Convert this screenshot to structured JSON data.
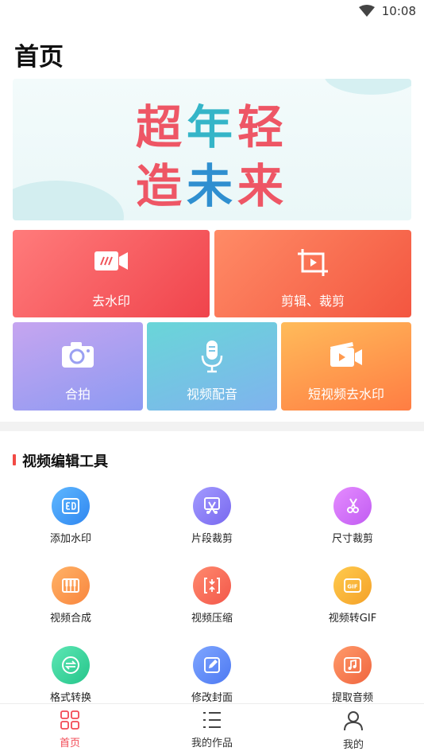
{
  "status_bar": {
    "time": "10:08"
  },
  "page_title": "首页",
  "banner": {
    "line1": [
      "超",
      "年",
      "轻"
    ],
    "line2": [
      "造",
      "未",
      "来"
    ]
  },
  "tiles": {
    "remove_watermark": "去水印",
    "crop": "剪辑、裁剪",
    "collab": "合拍",
    "dubbing": "视频配音",
    "short_video_watermark": "短视频去水印"
  },
  "section": {
    "title": "视频编辑工具"
  },
  "tools": [
    {
      "label": "添加水印",
      "icon": "add-watermark-icon",
      "color": "#3a8ff2"
    },
    {
      "label": "片段裁剪",
      "icon": "clip-cut-icon",
      "color": "#7f72f0"
    },
    {
      "label": "尺寸裁剪",
      "icon": "size-crop-icon",
      "color": "#c860f2"
    },
    {
      "label": "视频合成",
      "icon": "piano-icon",
      "color": "#f98d44"
    },
    {
      "label": "视频压缩",
      "icon": "compress-icon",
      "color": "#f35b4c"
    },
    {
      "label": "视频转GIF",
      "icon": "gif-icon",
      "color": "#f4a52b"
    },
    {
      "label": "格式转换",
      "icon": "convert-icon",
      "color": "#2ac98f"
    },
    {
      "label": "修改封面",
      "icon": "edit-cover-icon",
      "color": "#5580f2"
    },
    {
      "label": "提取音频",
      "icon": "music-icon",
      "color": "#f06a42"
    }
  ],
  "bottom_nav": {
    "home": "首页",
    "works": "我的作品",
    "mine": "我的"
  },
  "colors": {
    "accent": "#f24a55"
  }
}
